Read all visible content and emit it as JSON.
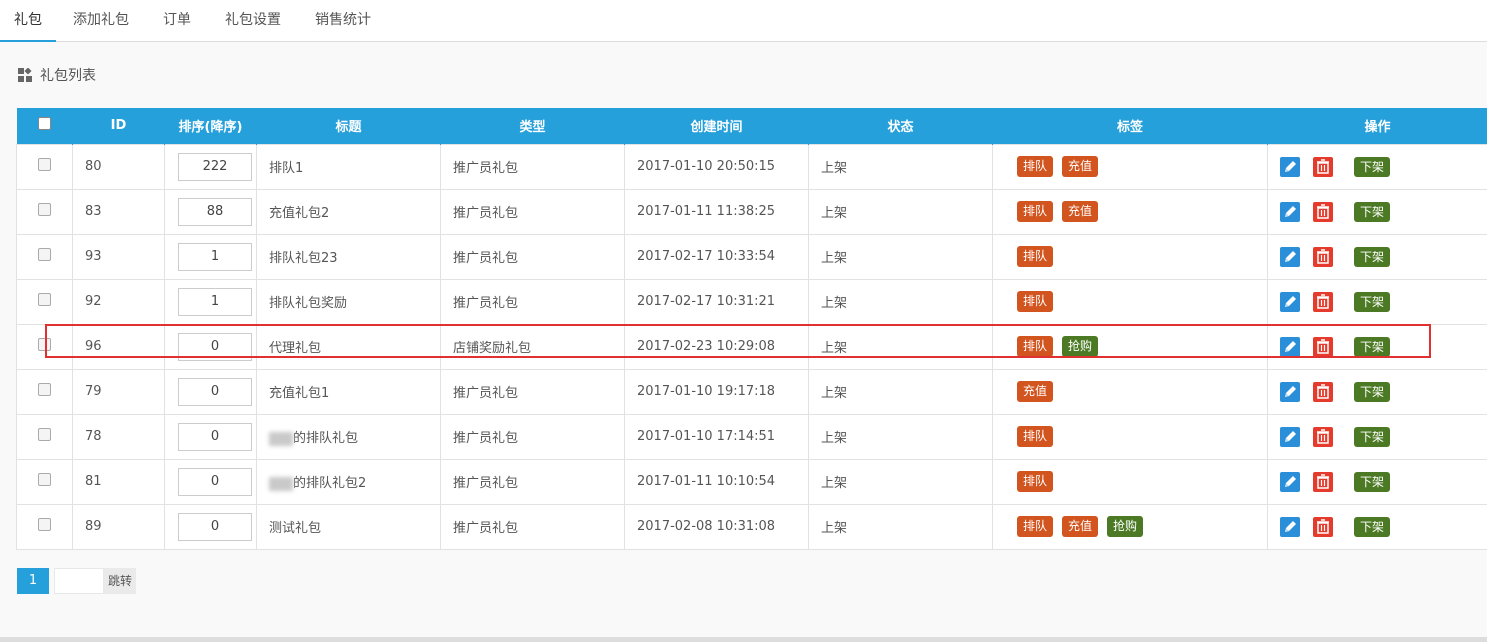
{
  "tabs": [
    "礼包",
    "添加礼包",
    "订单",
    "礼包设置",
    "销售统计"
  ],
  "section_title": "礼包列表",
  "columns": [
    "ID",
    "排序(降序)",
    "标题",
    "类型",
    "创建时间",
    "状态",
    "标签",
    "操作"
  ],
  "rows": [
    {
      "id": "80",
      "sort": "222",
      "title": "排队1",
      "type": "推广员礼包",
      "created": "2017-01-10 20:50:15",
      "status": "上架",
      "tags": [
        "排队",
        "充值"
      ]
    },
    {
      "id": "83",
      "sort": "88",
      "title": "充值礼包2",
      "type": "推广员礼包",
      "created": "2017-01-11 11:38:25",
      "status": "上架",
      "tags": [
        "排队",
        "充值"
      ]
    },
    {
      "id": "93",
      "sort": "1",
      "title": "排队礼包23",
      "type": "推广员礼包",
      "created": "2017-02-17 10:33:54",
      "status": "上架",
      "tags": [
        "排队"
      ]
    },
    {
      "id": "92",
      "sort": "1",
      "title": "排队礼包奖励",
      "type": "推广员礼包",
      "created": "2017-02-17 10:31:21",
      "status": "上架",
      "tags": [
        "排队"
      ]
    },
    {
      "id": "96",
      "sort": "0",
      "title": "代理礼包",
      "type": "店铺奖励礼包",
      "created": "2017-02-23 10:29:08",
      "status": "上架",
      "tags": [
        "排队",
        "抢购"
      ]
    },
    {
      "id": "79",
      "sort": "0",
      "title": "充值礼包1",
      "type": "推广员礼包",
      "created": "2017-01-10 19:17:18",
      "status": "上架",
      "tags": [
        "充值"
      ]
    },
    {
      "id": "78",
      "sort": "0",
      "title": "的排队礼包",
      "title_prefix_redacted": true,
      "type": "推广员礼包",
      "created": "2017-01-10 17:14:51",
      "status": "上架",
      "tags": [
        "排队"
      ]
    },
    {
      "id": "81",
      "sort": "0",
      "title": "的排队礼包2",
      "title_prefix_redacted": true,
      "type": "推广员礼包",
      "created": "2017-01-11 10:10:54",
      "status": "上架",
      "tags": [
        "排队"
      ]
    },
    {
      "id": "89",
      "sort": "0",
      "title": "测试礼包",
      "type": "推广员礼包",
      "created": "2017-02-08 10:31:08",
      "status": "上架",
      "tags": [
        "排队",
        "充值",
        "抢购"
      ]
    }
  ],
  "tag_colors": {
    "排队": "#d2541e",
    "充值": "#d2541e",
    "抢购": "#4c7a24"
  },
  "row_action_label": "下架",
  "pager": {
    "current": "1",
    "jump_label": "跳转"
  },
  "colors": {
    "header": "#26a0da",
    "highlight": "#e03030"
  }
}
